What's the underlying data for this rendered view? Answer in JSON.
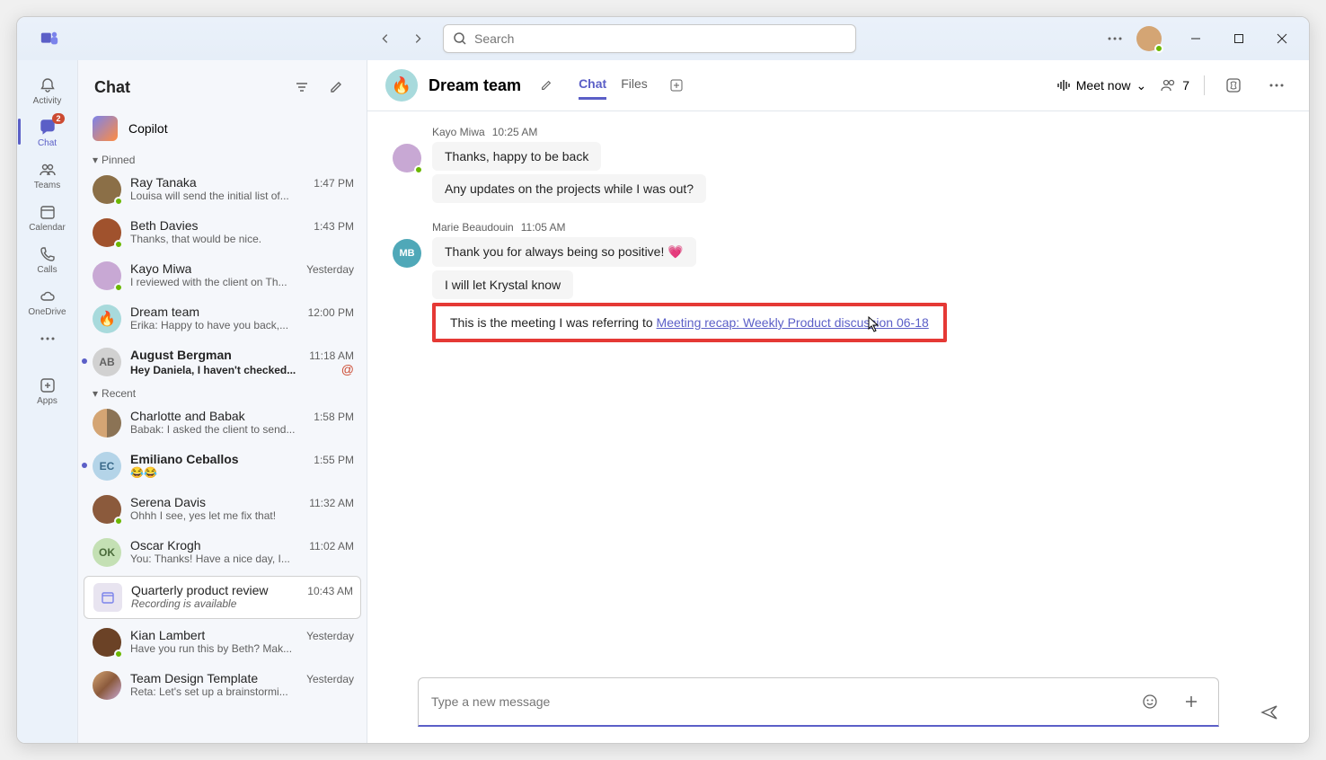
{
  "titlebar": {
    "search_placeholder": "Search"
  },
  "rail": {
    "activity": "Activity",
    "chat": "Chat",
    "chat_badge": "2",
    "teams": "Teams",
    "calendar": "Calendar",
    "calls": "Calls",
    "onedrive": "OneDrive",
    "apps": "Apps"
  },
  "chatlist": {
    "title": "Chat",
    "copilot": "Copilot",
    "pinned_label": "Pinned",
    "recent_label": "Recent",
    "pinned": [
      {
        "name": "Ray Tanaka",
        "preview": "Louisa will send the initial list of...",
        "time": "1:47 PM"
      },
      {
        "name": "Beth Davies",
        "preview": "Thanks, that would be nice.",
        "time": "1:43 PM"
      },
      {
        "name": "Kayo Miwa",
        "preview": "I reviewed with the client on Th...",
        "time": "Yesterday"
      },
      {
        "name": "Dream team",
        "preview": "Erika: Happy to have you back,...",
        "time": "12:00 PM"
      },
      {
        "name": "August Bergman",
        "preview": "Hey Daniela, I haven't checked...",
        "time": "11:18 AM"
      }
    ],
    "recent": [
      {
        "name": "Charlotte and Babak",
        "preview": "Babak: I asked the client to send...",
        "time": "1:58 PM"
      },
      {
        "name": "Emiliano Ceballos",
        "preview": "😂😂",
        "time": "1:55 PM"
      },
      {
        "name": "Serena Davis",
        "preview": "Ohhh I see, yes let me fix that!",
        "time": "11:32 AM"
      },
      {
        "name": "Oscar Krogh",
        "preview": "You: Thanks! Have a nice day, I...",
        "time": "11:02 AM"
      },
      {
        "name": "Quarterly product review",
        "preview": "Recording is available",
        "time": "10:43 AM"
      },
      {
        "name": "Kian Lambert",
        "preview": "Have you run this by Beth? Mak...",
        "time": "Yesterday"
      },
      {
        "name": "Team Design Template",
        "preview": "Reta: Let's set up a brainstormi...",
        "time": "Yesterday"
      }
    ]
  },
  "chatheader": {
    "title": "Dream team",
    "tab_chat": "Chat",
    "tab_files": "Files",
    "meet_now": "Meet now",
    "participants": "7"
  },
  "messages": {
    "g1_sender": "Kayo Miwa",
    "g1_time": "10:25 AM",
    "g1_m1": "Thanks, happy to be back",
    "g1_m2": "Any updates on the projects while I was out?",
    "g2_sender": "Marie Beaudouin",
    "g2_time": "11:05 AM",
    "g2_m1": "Thank you for always being so positive! 💗",
    "g2_m2": "I will let Krystal know",
    "g2_m3_pre": "This is the meeting I was referring to ",
    "g2_m3_link": "Meeting recap: Weekly Product discussion 06-18"
  },
  "composer": {
    "placeholder": "Type a new message"
  },
  "avatars": {
    "ab": "AB",
    "mb": "MB",
    "ec": "EC",
    "ok": "OK"
  }
}
